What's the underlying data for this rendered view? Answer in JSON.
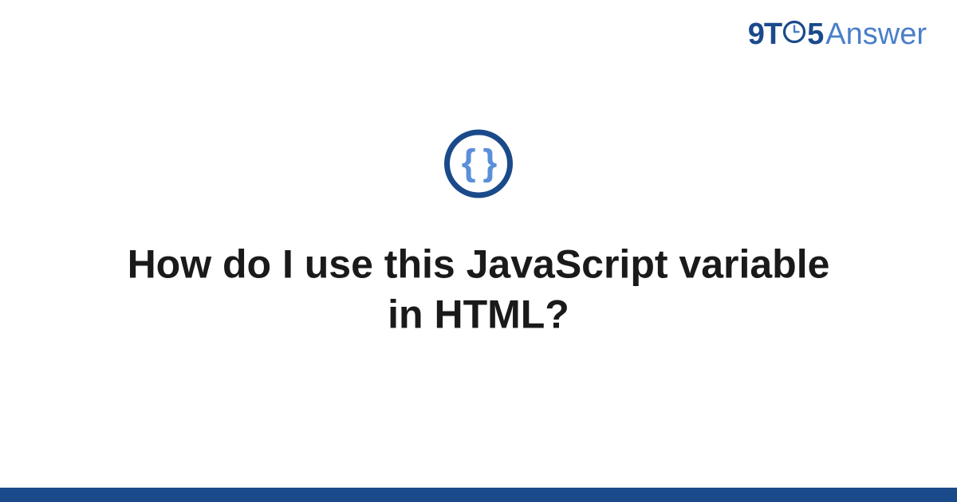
{
  "logo": {
    "prefix": "9T",
    "middle_digit": "5",
    "suffix": "Answer"
  },
  "main": {
    "icon_label": "code-braces-icon",
    "title": "How do I use this JavaScript variable in HTML?"
  },
  "colors": {
    "brand_dark": "#1a4a8a",
    "brand_light": "#4a7fc9",
    "brace_blue": "#5a8fd9"
  }
}
